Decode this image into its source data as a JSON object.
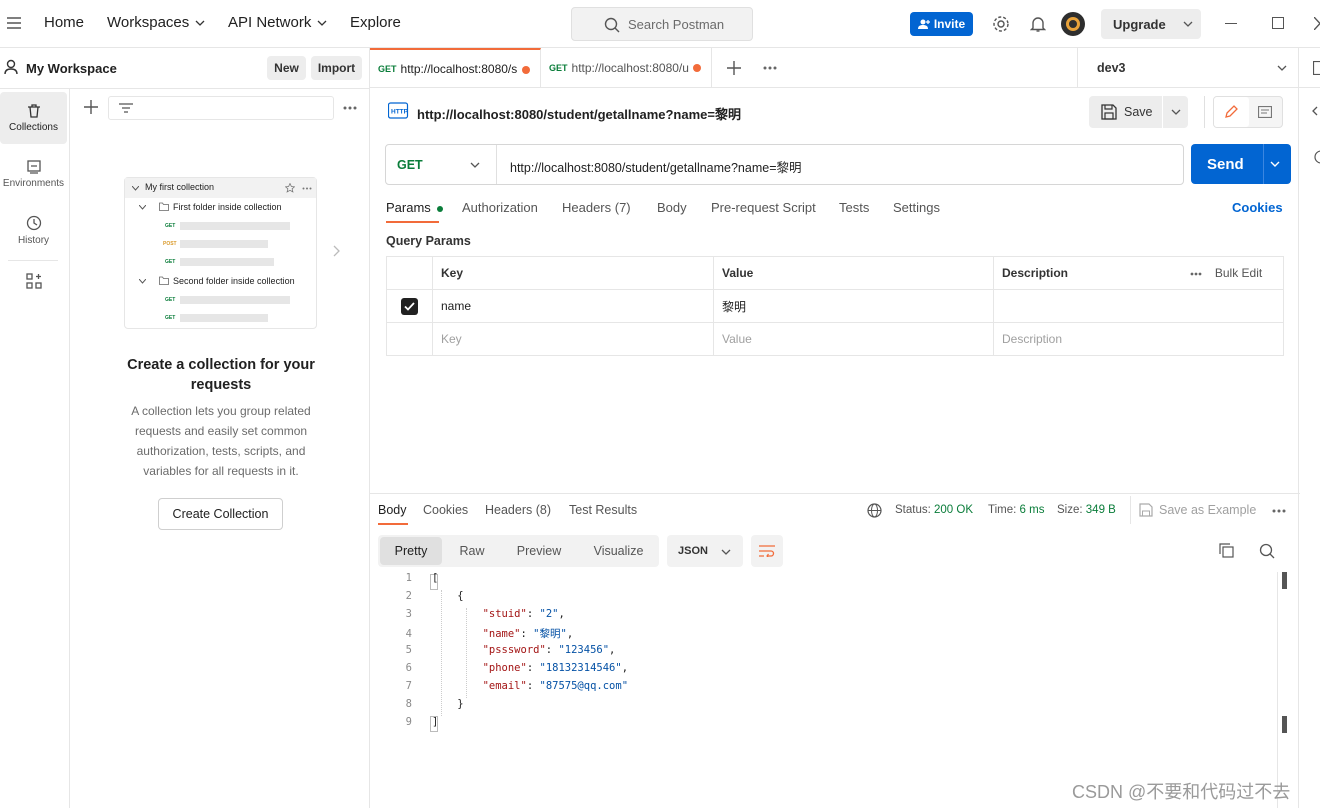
{
  "topbar": {
    "nav": [
      "Home",
      "Workspaces",
      "API Network",
      "Explore"
    ],
    "search_placeholder": "Search Postman",
    "invite_label": "Invite",
    "upgrade_label": "Upgrade"
  },
  "sidebar": {
    "workspace_name": "My Workspace",
    "new_label": "New",
    "import_label": "Import",
    "rail": [
      {
        "label": "Collections",
        "icon": "trash-icon"
      },
      {
        "label": "Environments",
        "icon": "environment-icon"
      },
      {
        "label": "History",
        "icon": "history-icon"
      },
      {
        "label": "",
        "icon": "grid-add-icon"
      }
    ],
    "preview": {
      "title": "My first collection",
      "folder1": "First folder inside collection",
      "folder2": "Second folder inside collection",
      "methods1": [
        "GET",
        "POST",
        "GET"
      ],
      "methods2": [
        "GET",
        "GET"
      ]
    },
    "empty_title": "Create a collection for your requests",
    "empty_desc": "A collection lets you group related requests and easily set common authorization, tests, scripts, and variables for all requests in it.",
    "create_label": "Create Collection"
  },
  "tabs": [
    {
      "method": "GET",
      "url": "http://localhost:8080/s"
    },
    {
      "method": "GET",
      "url": "http://localhost:8080/u"
    }
  ],
  "environment": "dev3",
  "request": {
    "title": "http://localhost:8080/student/getallname?name=黎明",
    "save_label": "Save",
    "method": "GET",
    "url": "http://localhost:8080/student/getallname?name=黎明",
    "send_label": "Send",
    "subtabs": [
      "Params",
      "Authorization",
      "Headers (7)",
      "Body",
      "Pre-request Script",
      "Tests",
      "Settings"
    ],
    "cookies_label": "Cookies",
    "query_params_label": "Query Params",
    "columns": [
      "Key",
      "Value",
      "Description"
    ],
    "bulk_edit_label": "Bulk Edit",
    "row": {
      "key": "name",
      "value": "黎明",
      "description": ""
    },
    "placeholder_row": {
      "key": "Key",
      "value": "Value",
      "description": "Description"
    }
  },
  "response": {
    "tabs": [
      "Body",
      "Cookies",
      "Headers (8)",
      "Test Results"
    ],
    "status_label": "Status:",
    "status_value": "200 OK",
    "time_label": "Time:",
    "time_value": "6 ms",
    "size_label": "Size:",
    "size_value": "349 B",
    "save_example_label": "Save as Example",
    "views": [
      "Pretty",
      "Raw",
      "Preview",
      "Visualize"
    ],
    "format": "JSON",
    "body": {
      "stuid": "2",
      "name": "黎明",
      "psssword": "123456",
      "phone": "18132314546",
      "email": "87575@qq.com"
    }
  },
  "watermark": "CSDN @不要和代码过不去",
  "colors": {
    "accent": "#0265d2",
    "orange": "#f26b3a",
    "green": "#0a7d3a"
  }
}
